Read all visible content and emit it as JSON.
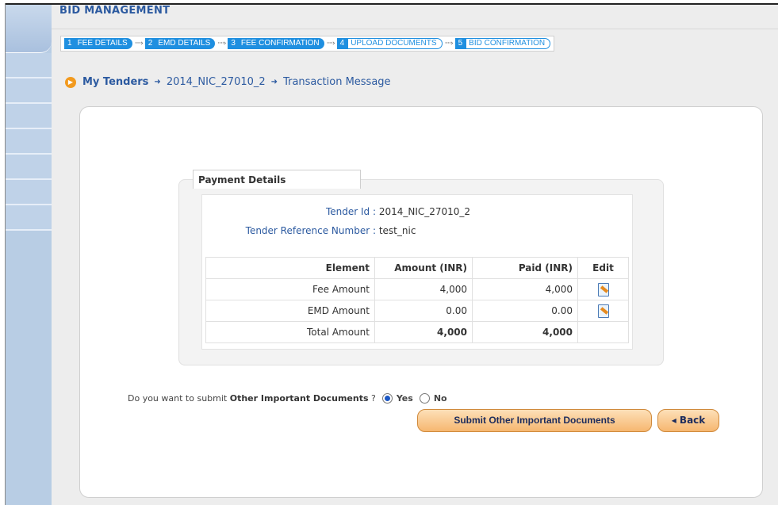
{
  "header": {
    "title": "BID MANAGEMENT"
  },
  "steps": [
    {
      "num": "1",
      "label": "FEE DETAILS",
      "state": "done"
    },
    {
      "num": "2",
      "label": "EMD DETAILS",
      "state": "done"
    },
    {
      "num": "3",
      "label": "FEE CONFIRMATION",
      "state": "done"
    },
    {
      "num": "4",
      "label": "UPLOAD DOCUMENTS",
      "state": "pending"
    },
    {
      "num": "5",
      "label": "BID CONFIRMATION",
      "state": "pending"
    }
  ],
  "breadcrumb": {
    "root": "My Tenders",
    "tender": "2014_NIC_27010_2",
    "current": "Transaction Message"
  },
  "payment": {
    "title": "Payment Details",
    "tender_id_label": "Tender Id :",
    "tender_id": "2014_NIC_27010_2",
    "ref_label": "Tender Reference Number :",
    "ref_value": "test_nic",
    "headers": {
      "element": "Element",
      "amount": "Amount (INR)",
      "paid": "Paid (INR)",
      "edit": "Edit"
    },
    "rows": [
      {
        "element": "Fee Amount",
        "amount": "4,000",
        "paid": "4,000"
      },
      {
        "element": "EMD Amount",
        "amount": "0.00",
        "paid": "0.00"
      }
    ],
    "total": {
      "element": "Total Amount",
      "amount": "4,000",
      "paid": "4,000"
    }
  },
  "question": {
    "prefix": "Do you want to submit",
    "bold": "Other Important Documents",
    "suffix": "?",
    "yes": "Yes",
    "no": "No",
    "selected": "Yes"
  },
  "buttons": {
    "submit": "Submit Other Important Documents",
    "back": "◂ Back"
  },
  "colors": {
    "accent": "#1f8fe0",
    "link": "#2c5aa0",
    "button": "#f6b770"
  }
}
